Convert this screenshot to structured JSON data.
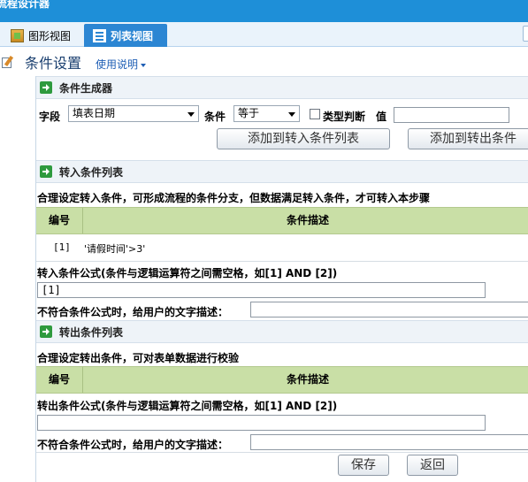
{
  "window": {
    "title": "流程设计器"
  },
  "tabs": [
    {
      "label": "图形视图"
    },
    {
      "label": "列表视图"
    }
  ],
  "header": {
    "title": "条件设置",
    "help": "使用说明"
  },
  "builder": {
    "section": "条件生成器",
    "field_label": "字段",
    "field_value": "填表日期",
    "condition_label": "条件",
    "condition_value": "等于",
    "type_check_label": "类型判断",
    "value_label": "值",
    "value": "",
    "add_in_button": "添加到转入条件列表",
    "add_out_button": "添加到转出条件"
  },
  "incoming": {
    "section": "转入条件列表",
    "hint": "合理设定转入条件，可形成流程的条件分支，但数据满足转入条件，才可转入本步骤",
    "col_no": "编号",
    "col_desc": "条件描述",
    "rows": [
      {
        "no": "[1]",
        "desc": "'请假时间'>3'"
      }
    ],
    "formula_label": "转入条件公式(条件与逻辑运算符之间需空格，如[1] AND [2])",
    "formula_value": "[1]",
    "msg_label": "不符合条件公式时，给用户的文字描述：",
    "msg_value": ""
  },
  "outgoing": {
    "section": "转出条件列表",
    "hint": "合理设定转出条件，可对表单数据进行校验",
    "col_no": "编号",
    "col_desc": "条件描述",
    "formula_label": "转出条件公式(条件与逻辑运算符之间需空格，如[1] AND [2])",
    "formula_value": "",
    "msg_label": "不符合条件公式时，给用户的文字描述：",
    "msg_value": ""
  },
  "footer": {
    "save": "保存",
    "back": "返回"
  }
}
